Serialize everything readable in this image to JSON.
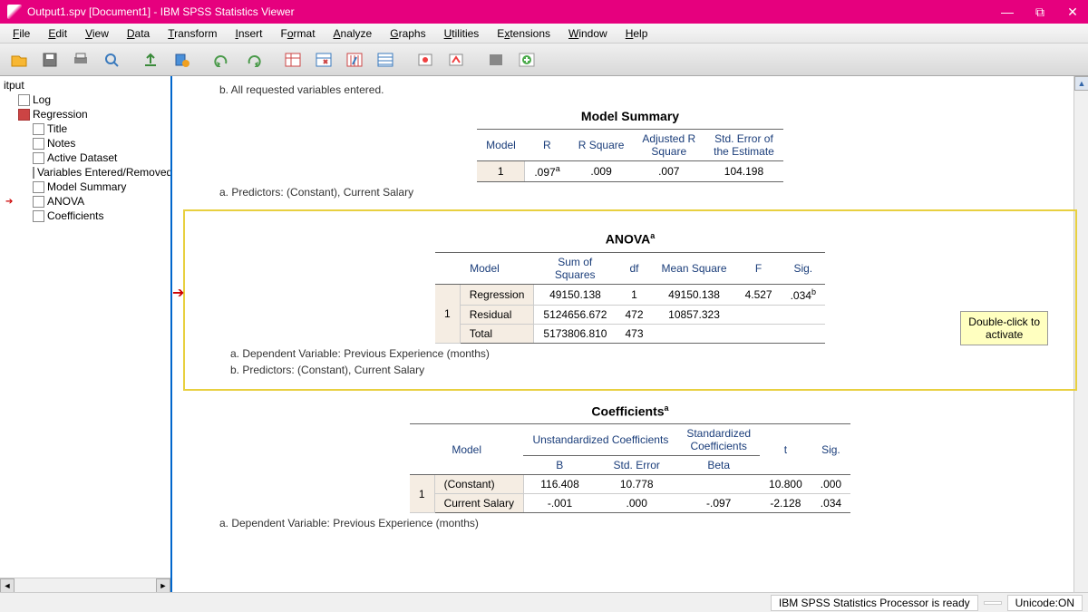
{
  "title": "Output1.spv [Document1] - IBM SPSS Statistics Viewer",
  "menus": [
    "File",
    "Edit",
    "View",
    "Data",
    "Transform",
    "Insert",
    "Format",
    "Analyze",
    "Graphs",
    "Utilities",
    "Extensions",
    "Window",
    "Help"
  ],
  "tree": {
    "root": "itput",
    "items": [
      "Log",
      "Regression"
    ],
    "regression_children": [
      "Title",
      "Notes",
      "Active Dataset",
      "Variables Entered/Removed",
      "Model Summary",
      "ANOVA",
      "Coefficients"
    ]
  },
  "content": {
    "vars_note": "b. All requested variables entered.",
    "ms": {
      "title": "Model Summary",
      "headers": [
        "Model",
        "R",
        "R Square",
        "Adjusted R Square",
        "Std. Error of the Estimate"
      ],
      "row": {
        "model": "1",
        "r": ".097",
        "r_sup": "a",
        "r2": ".009",
        "adj": ".007",
        "se": "104.198"
      },
      "foot": "a. Predictors: (Constant), Current Salary"
    },
    "anova": {
      "title": "ANOVA",
      "sup": "a",
      "headers": [
        "Model",
        "",
        "Sum of Squares",
        "df",
        "Mean Square",
        "F",
        "Sig."
      ],
      "rows": [
        {
          "model": "1",
          "label": "Regression",
          "ss": "49150.138",
          "df": "1",
          "ms": "49150.138",
          "f": "4.527",
          "sig": ".034",
          "sig_sup": "b"
        },
        {
          "model": "",
          "label": "Residual",
          "ss": "5124656.672",
          "df": "472",
          "ms": "10857.323",
          "f": "",
          "sig": ""
        },
        {
          "model": "",
          "label": "Total",
          "ss": "5173806.810",
          "df": "473",
          "ms": "",
          "f": "",
          "sig": ""
        }
      ],
      "foot_a": "a. Dependent Variable: Previous Experience (months)",
      "foot_b": "b. Predictors: (Constant), Current Salary",
      "tooltip": "Double-click to activate"
    },
    "coef": {
      "title": "Coefficients",
      "sup": "a",
      "group1": "Unstandardized Coefficients",
      "group2": "Standardized Coefficients",
      "headers": [
        "Model",
        "",
        "B",
        "Std. Error",
        "Beta",
        "t",
        "Sig."
      ],
      "rows": [
        {
          "model": "1",
          "label": "(Constant)",
          "b": "116.408",
          "se": "10.778",
          "beta": "",
          "t": "10.800",
          "sig": ".000"
        },
        {
          "model": "",
          "label": "Current Salary",
          "b": "-.001",
          "se": ".000",
          "beta": "-.097",
          "t": "-2.128",
          "sig": ".034"
        }
      ],
      "foot": "a. Dependent Variable: Previous Experience (months)"
    }
  },
  "status": {
    "processor": "IBM SPSS Statistics Processor is ready",
    "unicode": "Unicode:ON"
  }
}
